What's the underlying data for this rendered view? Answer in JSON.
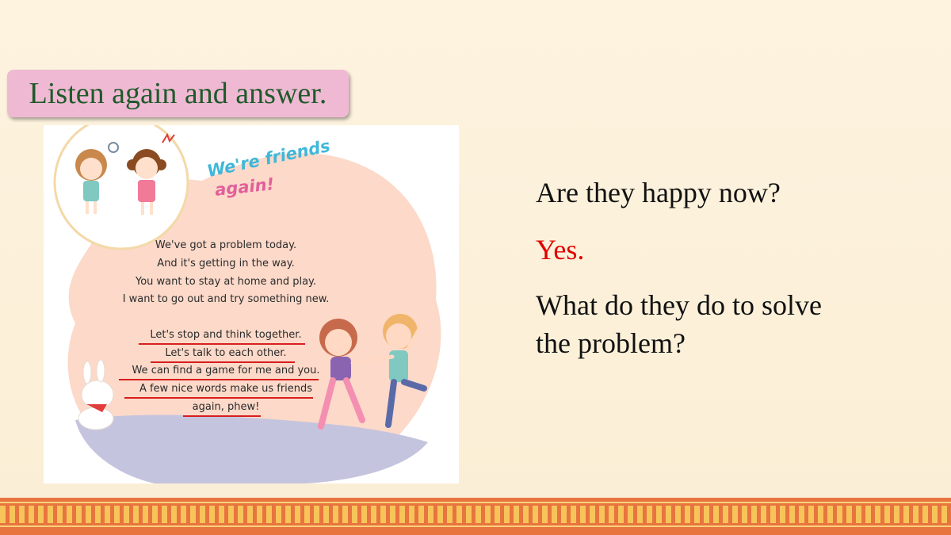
{
  "title": "Listen again and answer.",
  "poem": {
    "heading_line1": "We're friends",
    "heading_line2": "again!",
    "lines": [
      "We've got a problem today.",
      "And it's getting in the way.",
      "You want to stay at home and play.",
      "I want to go out and try something new."
    ],
    "underlined_lines": [
      "Let's stop and think together.",
      "Let's talk to each other.",
      "We can find a game for me and you.",
      "A few nice words make us friends",
      "again, phew!"
    ]
  },
  "questions": {
    "q1": "Are they happy now?",
    "a1": "Yes.",
    "q2_line1": "What do they do to solve",
    "q2_line2": "the problem?"
  },
  "colors": {
    "title_bg": "#f0b9d3",
    "title_text": "#1f5a2a",
    "answer": "#e00000",
    "underline": "#d81e1e"
  }
}
